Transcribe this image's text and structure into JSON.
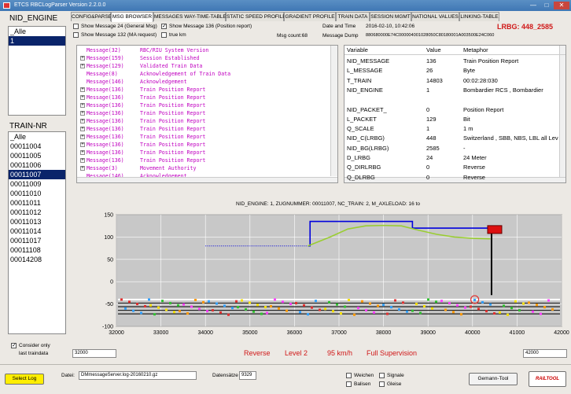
{
  "window": {
    "title": "ETCS RBCLogParser Version 2.2.0.0",
    "minimize": "—",
    "maximize": "□",
    "close": "✕"
  },
  "nid_engine": {
    "heading": "NID_ENGINE",
    "items": [
      "_Alle",
      "1"
    ],
    "selected": 1
  },
  "train_nr": {
    "heading": "TRAIN-NR",
    "items": [
      "_Alle",
      "00011004",
      "00011005",
      "00011006",
      "00011007",
      "00011009",
      "00011010",
      "00011011",
      "00011012",
      "00011013",
      "00011014",
      "00011017",
      "00011108",
      "00014208"
    ],
    "selected": 4
  },
  "consider": {
    "label_line1": "Consider only",
    "label_line2": "last traindata"
  },
  "tabs": [
    "CONFIG&PARSE",
    "MSG BROWSER",
    "MESSAGES WAY-TIME-TABLE",
    "STATIC SPEED PROFILE",
    "GRADIENT PROFILE",
    "TRAIN DATA",
    "SESSION MGMT",
    "NATIONAL VALUES",
    "LINKING-TABLE"
  ],
  "active_tab": 1,
  "filters": {
    "msg24": "Show Message 24 (General Msg)",
    "msg132": "Show Message 132 (MA request)",
    "msg136": "Show Message 136 (Position report)",
    "true_km": "true km"
  },
  "msg_count": "Msg count:68",
  "date_time_label": "Date and Time",
  "date_time_value": "2016-02-10, 10:42:06",
  "message_dump_label": "Message Dump",
  "message_dump_value": "880680000E74C000004001028050C80180001A003500E24C060",
  "lrbg": "LRBG: 448_2585",
  "tree": [
    {
      "msg": "Message(32)",
      "desc": "RBC/RIU System Version",
      "exp": false
    },
    {
      "msg": "Message(159)",
      "desc": "Session Established",
      "exp": true
    },
    {
      "msg": "Message(129)",
      "desc": "Validated Train Data",
      "exp": true
    },
    {
      "msg": "Message(8)",
      "desc": "Acknowledgement of Train Data",
      "exp": false
    },
    {
      "msg": "Message(146)",
      "desc": "Acknowledgement",
      "exp": false
    },
    {
      "msg": "Message(136)",
      "desc": "Train Position Report",
      "exp": true
    },
    {
      "msg": "Message(136)",
      "desc": "Train Position Report",
      "exp": true
    },
    {
      "msg": "Message(136)",
      "desc": "Train Position Report",
      "exp": true
    },
    {
      "msg": "Message(136)",
      "desc": "Train Position Report",
      "exp": true
    },
    {
      "msg": "Message(136)",
      "desc": "Train Position Report",
      "exp": true
    },
    {
      "msg": "Message(136)",
      "desc": "Train Position Report",
      "exp": true
    },
    {
      "msg": "Message(136)",
      "desc": "Train Position Report",
      "exp": true
    },
    {
      "msg": "Message(136)",
      "desc": "Train Position Report",
      "exp": true
    },
    {
      "msg": "Message(136)",
      "desc": "Train Position Report",
      "exp": true
    },
    {
      "msg": "Message(136)",
      "desc": "Train Position Report",
      "exp": true
    },
    {
      "msg": "Message(3)",
      "desc": "Movement Authority",
      "exp": true
    },
    {
      "msg": "Message(146)",
      "desc": "Acknowledgement",
      "exp": false
    },
    {
      "msg": "Message(136)",
      "desc": "Train Position Report",
      "exp": true
    }
  ],
  "grid": {
    "headers": [
      "Variable",
      "Value",
      "Metaphor"
    ],
    "rows": [
      [
        "NID_MESSAGE",
        "136",
        "Train Position Report"
      ],
      [
        "L_MESSAGE",
        "26",
        "Byte"
      ],
      [
        "T_TRAIN",
        "14803",
        "00:02:28:030"
      ],
      [
        "NID_ENGINE",
        "1",
        "Bombardier RCS , Bombardier"
      ],
      [
        "",
        "",
        ""
      ],
      [
        "NID_PACKET_",
        "0",
        "Position Report"
      ],
      [
        "L_PACKET",
        "129",
        "Bit"
      ],
      [
        "Q_SCALE",
        "1",
        "1 m"
      ],
      [
        "NID_C(LRBG)",
        "448",
        "Switzerland , SBB, NBS, LBL all Lev"
      ],
      [
        "NID_BG(LRBG)",
        "2585",
        "-"
      ],
      [
        "D_LRBG",
        "24",
        "24 Meter"
      ],
      [
        "Q_DIRLRBG",
        "0",
        "Reverse"
      ],
      [
        "Q_DLRBG",
        "0",
        "Reverse"
      ]
    ]
  },
  "chart_data": {
    "type": "line",
    "title": "NID_ENGINE: 1, ZUGNUMMER: 00011007, NC_TRAIN: 2, M_AXLELOAD: 16 to",
    "xlim": [
      32000,
      42000
    ],
    "ylim": [
      -100,
      150
    ],
    "xticks": [
      32000,
      33000,
      34000,
      35000,
      36000,
      37000,
      38000,
      39000,
      40000,
      41000,
      42000
    ],
    "yticks": [
      150,
      100,
      50,
      0,
      -50,
      -100
    ],
    "series": [
      {
        "color": "#0000dd",
        "style": "dotted",
        "x": [
          34000,
          36300
        ],
        "y": [
          80,
          80
        ]
      },
      {
        "color": "#0000dd",
        "style": "solid",
        "x": [
          36300,
          36350,
          36350,
          38650,
          38650,
          40400,
          40400
        ],
        "y": [
          80,
          80,
          135,
          135,
          120,
          120,
          115
        ]
      },
      {
        "color": "#9acd32",
        "style": "solid",
        "x": [
          36300,
          36800,
          37200,
          37600,
          38000,
          38400,
          38800,
          39200,
          39600,
          40000,
          40400
        ],
        "y": [
          80,
          100,
          118,
          125,
          126,
          125,
          115,
          106,
          100,
          97,
          96
        ]
      }
    ],
    "train_x": 40480,
    "train_y": 115
  },
  "status": {
    "direction": "Reverse",
    "level": "Level 2",
    "speed": "95 km/h",
    "mode": "Full Supervision"
  },
  "range_from": "32000",
  "range_to": "42000",
  "bottom": {
    "select_log": "Select Log",
    "datei_label": "Datei:",
    "datei_value": "DMmessageServer.log-20160210.gz",
    "datensaetze_label": "Datensätze",
    "datensaetze_value": "9329",
    "weichen": "Weichen",
    "balisen": "Balisen",
    "signale": "Signale",
    "gleise": "Gleise",
    "gemann_tool": "Gemann-Tool",
    "railtool": "RAILTOOL"
  },
  "colors": {
    "accent": "#0a246a",
    "status": "#d01818",
    "lrbg": "#d01818",
    "select_log": "#ffee00"
  }
}
